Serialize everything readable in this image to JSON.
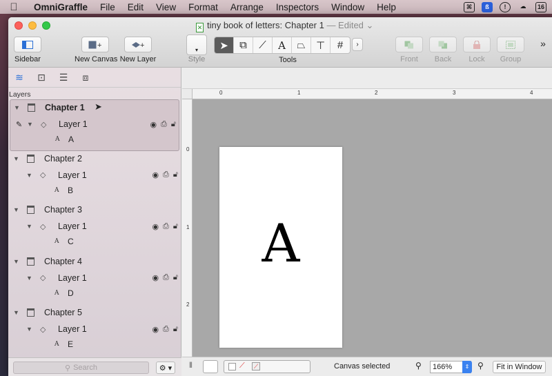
{
  "menubar": {
    "app": "OmniGraffle",
    "items": [
      "File",
      "Edit",
      "View",
      "Format",
      "Arrange",
      "Inspectors",
      "Window",
      "Help"
    ],
    "calendar_day": "16"
  },
  "window": {
    "title": "tiny book of letters: Chapter 1",
    "edited": "— Edited"
  },
  "toolbar": {
    "sidebar_label": "Sidebar",
    "new_canvas_label": "New Canvas",
    "new_layer_label": "New Layer",
    "style_label": "Style",
    "tools_label": "Tools",
    "front_label": "Front",
    "back_label": "Back",
    "lock_label": "Lock",
    "group_label": "Group"
  },
  "sidebar": {
    "section_label": "Layers",
    "search_placeholder": "Search",
    "chapters": [
      {
        "name": "Chapter 1",
        "layer": "Layer 1",
        "object_icon": "A",
        "object": "A"
      },
      {
        "name": "Chapter 2",
        "layer": "Layer 1",
        "object_icon": "A",
        "object": "B"
      },
      {
        "name": "Chapter 3",
        "layer": "Layer 1",
        "object_icon": "A",
        "object": "C"
      },
      {
        "name": "Chapter 4",
        "layer": "Layer 1",
        "object_icon": "A",
        "object": "D"
      },
      {
        "name": "Chapter 5",
        "layer": "Layer 1",
        "object_icon": "A",
        "object": "E"
      }
    ]
  },
  "ruler": {
    "top_ticks": [
      "0",
      "1",
      "2",
      "3",
      "4"
    ],
    "left_ticks": [
      "0",
      "1",
      "2"
    ]
  },
  "canvas": {
    "page_text": "A"
  },
  "statusbar": {
    "status": "Canvas selected",
    "zoom": "166%",
    "fit_label": "Fit in Window"
  }
}
